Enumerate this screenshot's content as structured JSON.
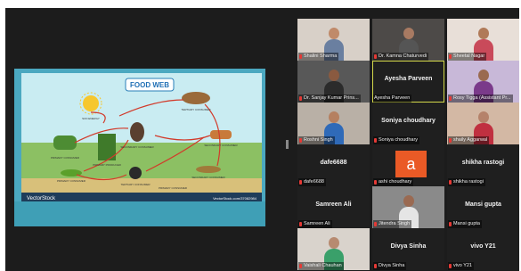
{
  "slide": {
    "title": "FOOD WEB",
    "labels": [
      "SUN ENERGY",
      "TERTIARY CONSUMER",
      "SECONDARY CONSUMER",
      "PRIMARY CONSUMER",
      "PRIMARY PRODUCER",
      "SECONDARY CONSUMER",
      "PRIMARY CONSUMER",
      "TERTIARY CONSUMER",
      "SECONDARY CONSUMER",
      "PRIMARY CONSUMER"
    ],
    "brand": "VectorStock",
    "brand_url": "VectorStock.com/37082984"
  },
  "participants": [
    {
      "name": "Shalini Sharma",
      "display": "",
      "video": true,
      "muted": true,
      "colors": {
        "bg": "#d8d0c8",
        "skin": "#c08a6a",
        "cloth": "#6a7fa0"
      }
    },
    {
      "name": "Dr. Kamna Chaturvedi",
      "display": "",
      "video": true,
      "muted": true,
      "colors": {
        "bg": "#4d4a48",
        "skin": "#a87a62",
        "cloth": "#555"
      }
    },
    {
      "name": "Sheetal Nagar",
      "display": "",
      "video": true,
      "muted": true,
      "colors": {
        "bg": "#e8dfd8",
        "skin": "#b07a58",
        "cloth": "#c94a5a"
      }
    },
    {
      "name": "Dr. Sanjay Kumar Prins...",
      "display": "",
      "video": true,
      "muted": true,
      "colors": {
        "bg": "#585858",
        "skin": "#8a5a40",
        "cloth": "#2b2b2b"
      }
    },
    {
      "name": "Ayesha Parveen",
      "display": "Ayesha Parveen",
      "video": false,
      "muted": false,
      "active": true
    },
    {
      "name": "Rosy Tigga (Assistant Pr...",
      "display": "",
      "video": true,
      "muted": true,
      "colors": {
        "bg": "#c8b8d8",
        "skin": "#9a6a50",
        "cloth": "#7a3a8a"
      }
    },
    {
      "name": "Roshni Singh",
      "display": "",
      "video": true,
      "muted": true,
      "colors": {
        "bg": "#b9b0a6",
        "skin": "#b58060",
        "cloth": "#2f6ab8"
      }
    },
    {
      "name": "Soniya choudhary",
      "display": "Soniya choudhary",
      "video": false,
      "muted": true
    },
    {
      "name": "shaily Aggarwal",
      "display": "",
      "video": true,
      "muted": true,
      "colors": {
        "bg": "#d3b8a4",
        "skin": "#b5826a",
        "cloth": "#c03040"
      }
    },
    {
      "name": "dafe6688",
      "display": "dafe6688",
      "video": false,
      "muted": true
    },
    {
      "name": "ashi choudhary",
      "display": "",
      "video": false,
      "muted": true,
      "avatar": "a"
    },
    {
      "name": "shikha rastogi",
      "display": "shikha rastogi",
      "video": false,
      "muted": true
    },
    {
      "name": "Samreen Ali",
      "display": "Samreen Ali",
      "video": false,
      "muted": true
    },
    {
      "name": "Jitendra Singh",
      "display": "",
      "video": true,
      "muted": true,
      "colors": {
        "bg": "#8a8a8a",
        "skin": "#9a6a52",
        "cloth": "#e5e5e5"
      }
    },
    {
      "name": "Mansi gupta",
      "display": "Mansi gupta",
      "video": false,
      "muted": true
    },
    {
      "name": "Vaishali Chauhan",
      "display": "",
      "video": true,
      "muted": true,
      "colors": {
        "bg": "#d9d3cc",
        "skin": "#b78a70",
        "cloth": "#3aa06a"
      }
    },
    {
      "name": "Divya Sinha",
      "display": "Divya Sinha",
      "video": false,
      "muted": true
    },
    {
      "name": "vivo Y21",
      "display": "vivo Y21",
      "video": false,
      "muted": true
    }
  ]
}
